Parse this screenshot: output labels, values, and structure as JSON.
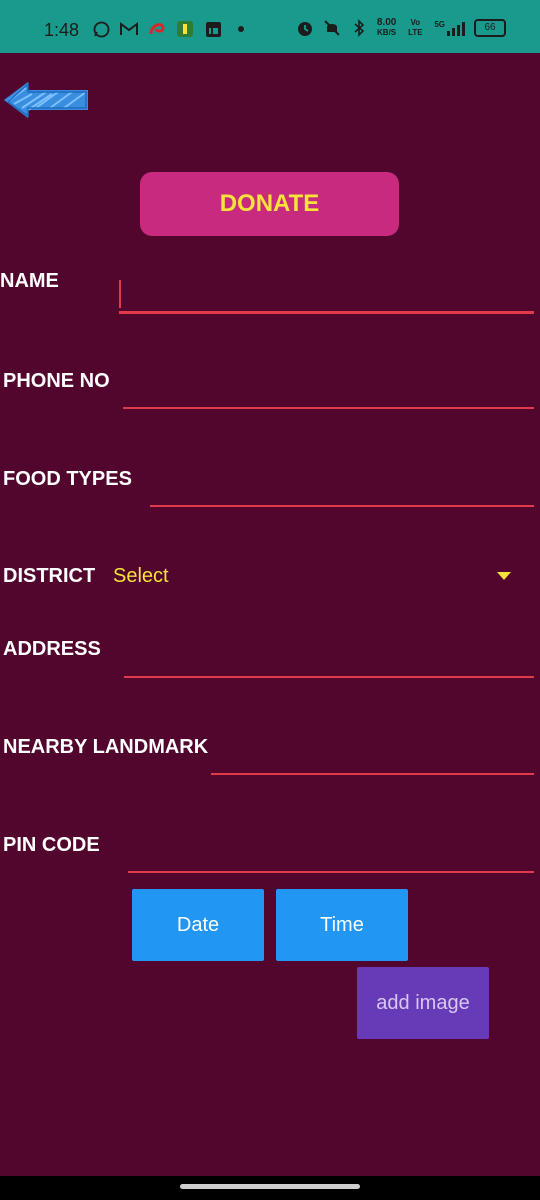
{
  "status_bar": {
    "time": "1:48",
    "left_icons": [
      "whatsapp-icon",
      "gmail-icon",
      "airtel-icon",
      "app-icon",
      "linkedin-icon",
      "dot-icon"
    ],
    "right_icons": [
      "alarm-icon",
      "mute-icon",
      "bluetooth-icon"
    ],
    "speed_value": "8.00",
    "speed_unit": "KB/S",
    "volte": "Vo LTE",
    "network": "5G",
    "battery": "66"
  },
  "back_button": {
    "icon": "back-arrow-icon"
  },
  "donate_button": {
    "label": "DONATE"
  },
  "form": {
    "name_label": "NAME",
    "phone_label": "PHONE NO",
    "food_types_label": "FOOD TYPES",
    "district_label": "DISTRICT",
    "district_value": "Select",
    "address_label": "ADDRESS",
    "landmark_label": "NEARBY LANDMARK",
    "pin_label": "PIN CODE"
  },
  "buttons": {
    "date_label": "Date",
    "time_label": "Time",
    "add_image_label": "add image"
  },
  "colors": {
    "background": "#53062d",
    "status_bar": "#1a9a8c",
    "donate_bg": "#c82a7f",
    "accent_yellow": "#f5e23a",
    "underline": "#e23a4a",
    "blue_button": "#2196f3",
    "purple_button": "#673ab7"
  }
}
